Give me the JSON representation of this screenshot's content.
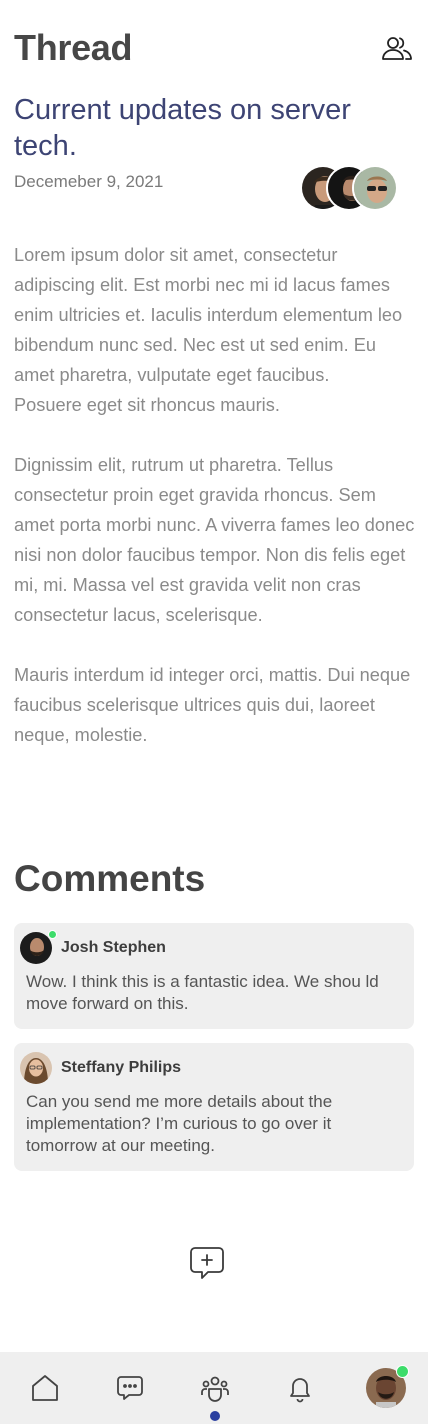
{
  "header": {
    "title": "Thread",
    "people_icon": "people-icon"
  },
  "post": {
    "title": "Current updates on server tech.",
    "date": "Decemeber 9, 2021",
    "participants": [
      "participant-1",
      "participant-2",
      "participant-3"
    ],
    "paragraphs": [
      "Lorem ipsum dolor sit amet, consectetur adipiscing elit. Est morbi nec mi id lacus fames enim ultricies et. Iaculis interdum elementum leo bibendum nunc sed. Nec est ut sed enim. Eu amet pharetra, vulputate eget faucibus.",
      "Posuere eget sit rhoncus mauris.",
      "Dignissim elit, rutrum ut pharetra. Tellus consectetur proin eget gravida rhoncus. Sem amet porta morbi nunc. A viverra fames leo donec nisi non dolor faucibus tempor. Non dis felis eget mi, mi. Massa vel est gravida velit non cras consectetur lacus, scelerisque.",
      "Mauris interdum id integer orci, mattis. Dui neque faucibus scelerisque ultrices quis dui, laoreet neque, molestie."
    ]
  },
  "comments": {
    "title": "Comments",
    "items": [
      {
        "name": "Josh Stephen",
        "text": "Wow. I think this is a fantastic idea. We shou ld move forward on this.",
        "online": true
      },
      {
        "name": "Steffany Philips",
        "text": "Can you send me more details about the implementation? I’m curious to go over it tomorrow at our meeting.",
        "online": false
      }
    ]
  },
  "new_comment_icon": "new-comment-icon",
  "tabbar": {
    "items": [
      "home-icon",
      "chat-icon",
      "team-icon",
      "bell-icon",
      "profile-avatar"
    ],
    "active": "team-icon"
  },
  "colors": {
    "title_accent": "#3d4474",
    "active_indicator": "#2a3fa0",
    "online": "#3ddc6a",
    "card_bg": "#efefef"
  }
}
